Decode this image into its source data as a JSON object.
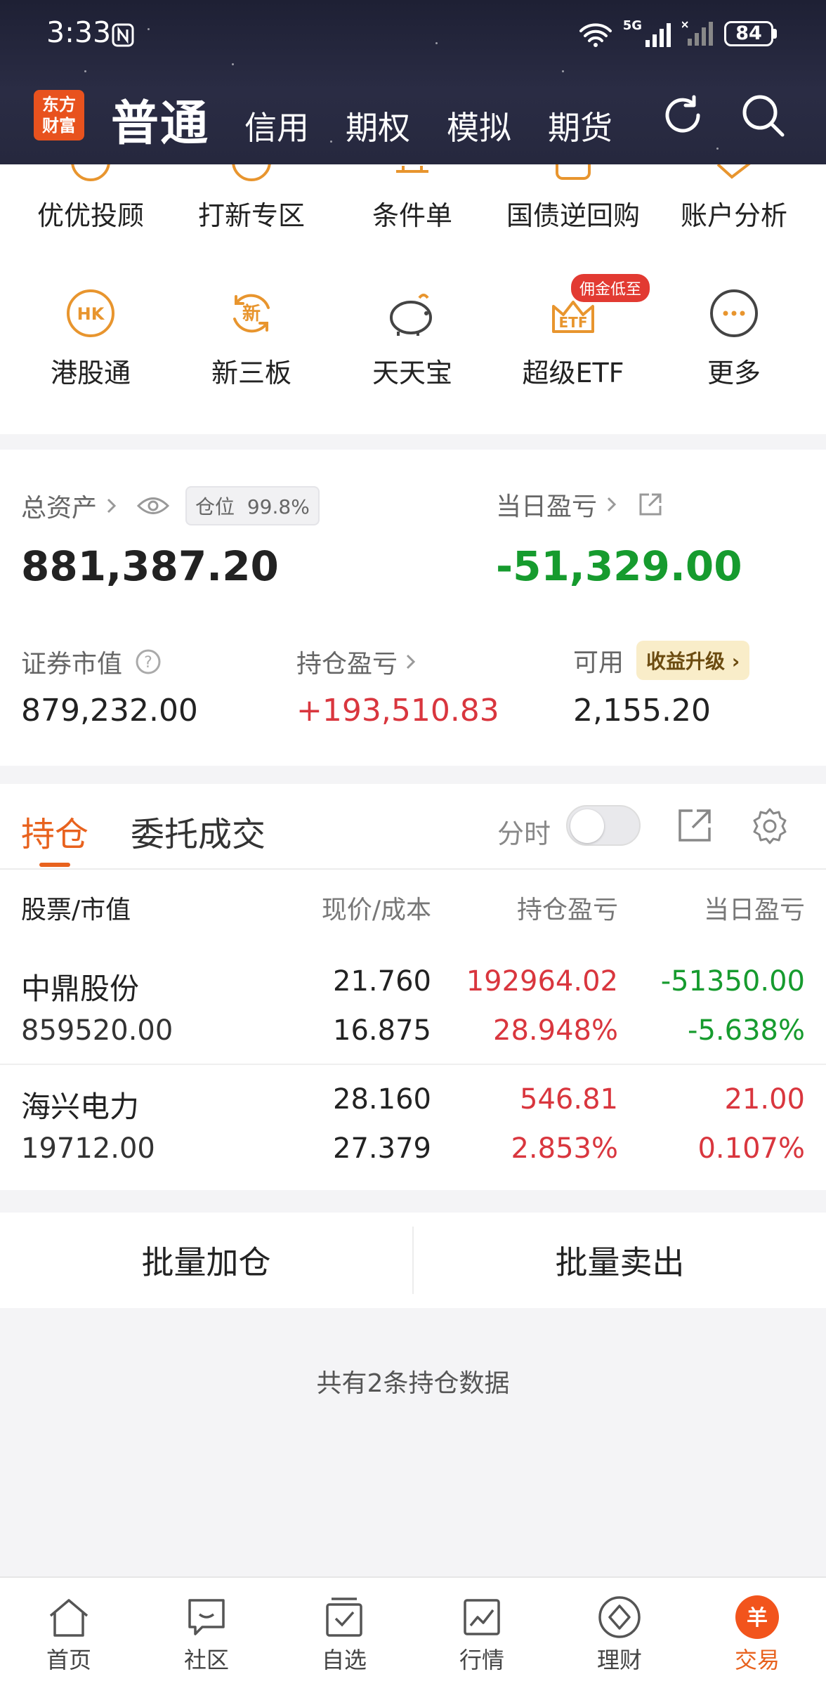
{
  "status_bar": {
    "time": "3:33",
    "network": "5G",
    "battery": "84"
  },
  "header": {
    "logo_line1": "东方",
    "logo_line2": "财富",
    "active_tab": "普通",
    "tabs": [
      "信用",
      "期权",
      "模拟",
      "期货"
    ]
  },
  "quick_menu": {
    "row1": [
      "优优投顾",
      "打新专区",
      "条件单",
      "国债逆回购",
      "账户分析"
    ],
    "row2": [
      {
        "label": "港股通",
        "icon_text": "HK"
      },
      {
        "label": "新三板",
        "icon_text": "新"
      },
      {
        "label": "天天宝",
        "icon_text": ""
      },
      {
        "label": "超级ETF",
        "icon_text": "ETF",
        "badge": "佣金低至"
      },
      {
        "label": "更多",
        "icon_text": "···"
      }
    ]
  },
  "assets": {
    "total_label": "总资产",
    "position_label": "仓位",
    "position_value": "99.8%",
    "total_value": "881,387.20",
    "daily_pl_label": "当日盈亏",
    "daily_pl_value": "-51,329.00",
    "market_value_label": "证券市值",
    "market_value": "879,232.00",
    "holding_pl_label": "持仓盈亏",
    "holding_pl_value": "+193,510.83",
    "available_label": "可用",
    "available_value": "2,155.20",
    "upgrade_label": "收益升级"
  },
  "holdings": {
    "tab_positions": "持仓",
    "tab_orders": "委托成交",
    "timeshare_label": "分时",
    "headers": {
      "stock": "股票/市值",
      "price": "现价/成本",
      "holding_pl": "持仓盈亏",
      "daily_pl": "当日盈亏"
    },
    "rows": [
      {
        "name": "中鼎股份",
        "market_value": "859520.00",
        "price": "21.760",
        "cost": "16.875",
        "holding_pl": "192964.02",
        "holding_pct": "28.948%",
        "daily_pl": "-51350.00",
        "daily_pct": "-5.638%"
      },
      {
        "name": "海兴电力",
        "market_value": "19712.00",
        "price": "28.160",
        "cost": "27.379",
        "holding_pl": "546.81",
        "holding_pct": "2.853%",
        "daily_pl": "21.00",
        "daily_pct": "0.107%"
      }
    ]
  },
  "batch": {
    "add": "批量加仓",
    "sell": "批量卖出"
  },
  "footnote": "共有2条持仓数据",
  "bottom_nav": [
    "首页",
    "社区",
    "自选",
    "行情",
    "理财",
    "交易"
  ],
  "colors": {
    "accent": "#e8621e",
    "gain": "#d9363e",
    "loss": "#169b2e"
  }
}
